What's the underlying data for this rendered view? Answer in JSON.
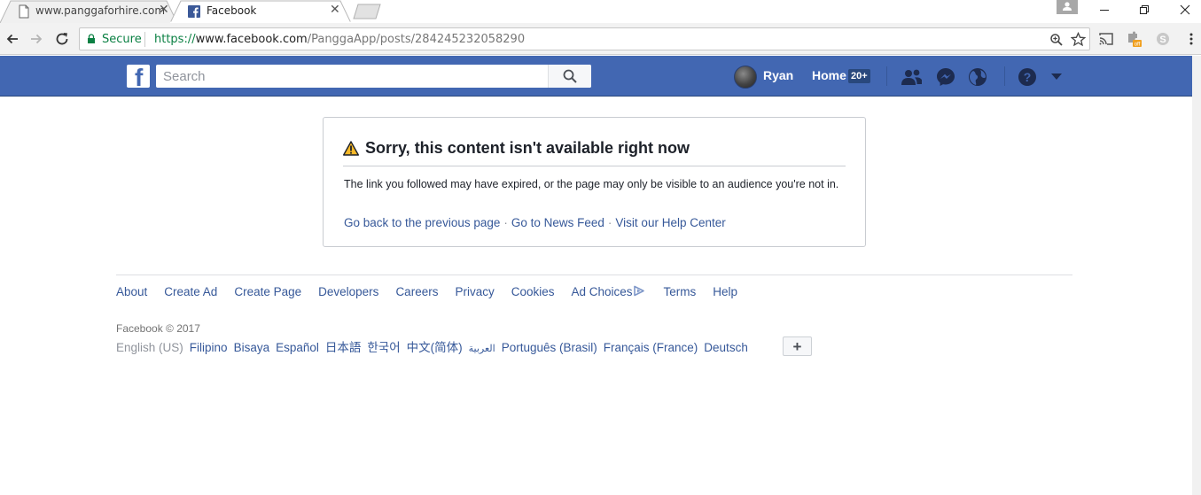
{
  "browser": {
    "tabs": [
      {
        "title": "www.panggaforhire.com",
        "active": false
      },
      {
        "title": "Facebook",
        "active": true
      }
    ],
    "secure_label": "Secure",
    "url": {
      "scheme": "https://",
      "host": "www.facebook.com",
      "path": "/PanggaApp/posts/284245232058290"
    }
  },
  "facebook_header": {
    "search_placeholder": "Search",
    "user_name": "Ryan",
    "home_label": "Home",
    "home_badge": "20+"
  },
  "error": {
    "title": "Sorry, this content isn't available right now",
    "body": "The link you followed may have expired, or the page may only be visible to an audience you're not in.",
    "links": [
      "Go back to the previous page",
      "Go to News Feed",
      "Visit our Help Center"
    ],
    "separator": "·"
  },
  "footer": {
    "links": [
      "About",
      "Create Ad",
      "Create Page",
      "Developers",
      "Careers",
      "Privacy",
      "Cookies",
      "Ad Choices",
      "Terms",
      "Help"
    ],
    "copyright": "Facebook © 2017",
    "languages": [
      {
        "label": "English (US)",
        "current": true
      },
      {
        "label": "Filipino",
        "current": false
      },
      {
        "label": "Bisaya",
        "current": false
      },
      {
        "label": "Español",
        "current": false
      },
      {
        "label": "日本語",
        "current": false
      },
      {
        "label": "한국어",
        "current": false
      },
      {
        "label": "中文(简体)",
        "current": false
      },
      {
        "label": "العربية",
        "current": false
      },
      {
        "label": "Português (Brasil)",
        "current": false
      },
      {
        "label": "Français (France)",
        "current": false
      },
      {
        "label": "Deutsch",
        "current": false
      }
    ],
    "more_languages_label": "+"
  },
  "colors": {
    "facebook_blue": "#4267b2",
    "link_blue": "#365899",
    "secure_green": "#0b8043",
    "warning_yellow": "#f7b928"
  }
}
